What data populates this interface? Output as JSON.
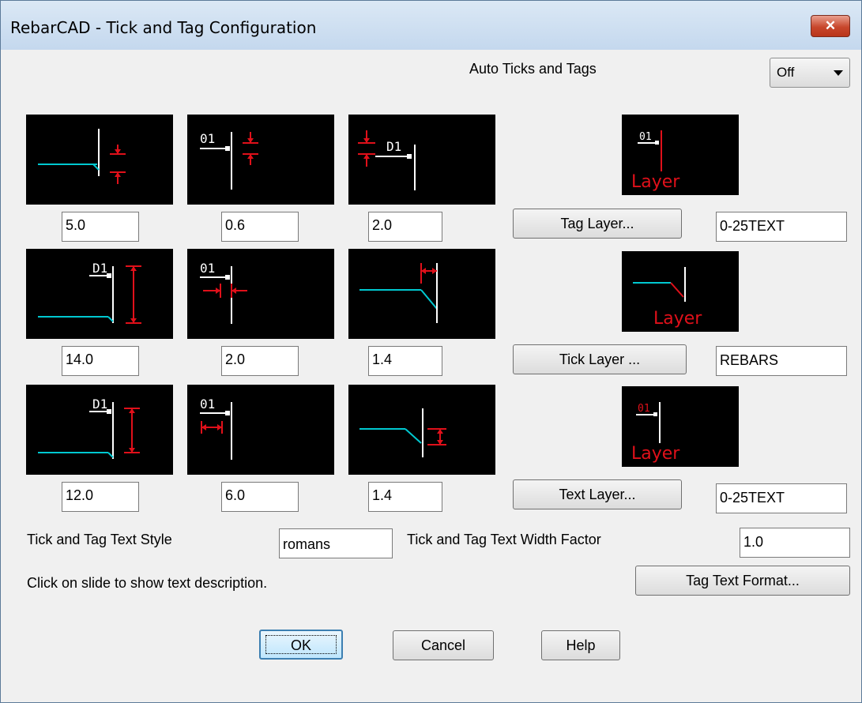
{
  "window": {
    "title": "RebarCAD - Tick and Tag Configuration",
    "close_symbol": "✕"
  },
  "auto": {
    "label": "Auto Ticks and Tags",
    "value": "Off"
  },
  "slides": {
    "tag_text": "D1",
    "tag_text_alt": "01",
    "layer_text": "Layer"
  },
  "values": {
    "r1c1": "5.0",
    "r1c2": "0.6",
    "r1c3": "2.0",
    "r2c1": "14.0",
    "r2c2": "2.0",
    "r2c3": "1.4",
    "r3c1": "12.0",
    "r3c2": "6.0",
    "r3c3": "1.4"
  },
  "layers": {
    "tag_button": "Tag Layer...",
    "tag_value": "0-25TEXT",
    "tick_button": "Tick Layer ...",
    "tick_value": "REBARS",
    "text_button": "Text Layer...",
    "text_value": "0-25TEXT"
  },
  "style": {
    "text_style_label": "Tick and Tag Text Style",
    "text_style_value": "romans",
    "width_factor_label": "Tick and Tag Text Width Factor",
    "width_factor_value": "1.0"
  },
  "hint": "Click on slide to show text description.",
  "buttons": {
    "tag_text_format": "Tag Text Format...",
    "ok": "OK",
    "cancel": "Cancel",
    "help": "Help"
  },
  "colors": {
    "slide_bg": "#000000",
    "rebar": "#00c8d0",
    "dim": "#e0101a",
    "line": "#ffffff"
  }
}
